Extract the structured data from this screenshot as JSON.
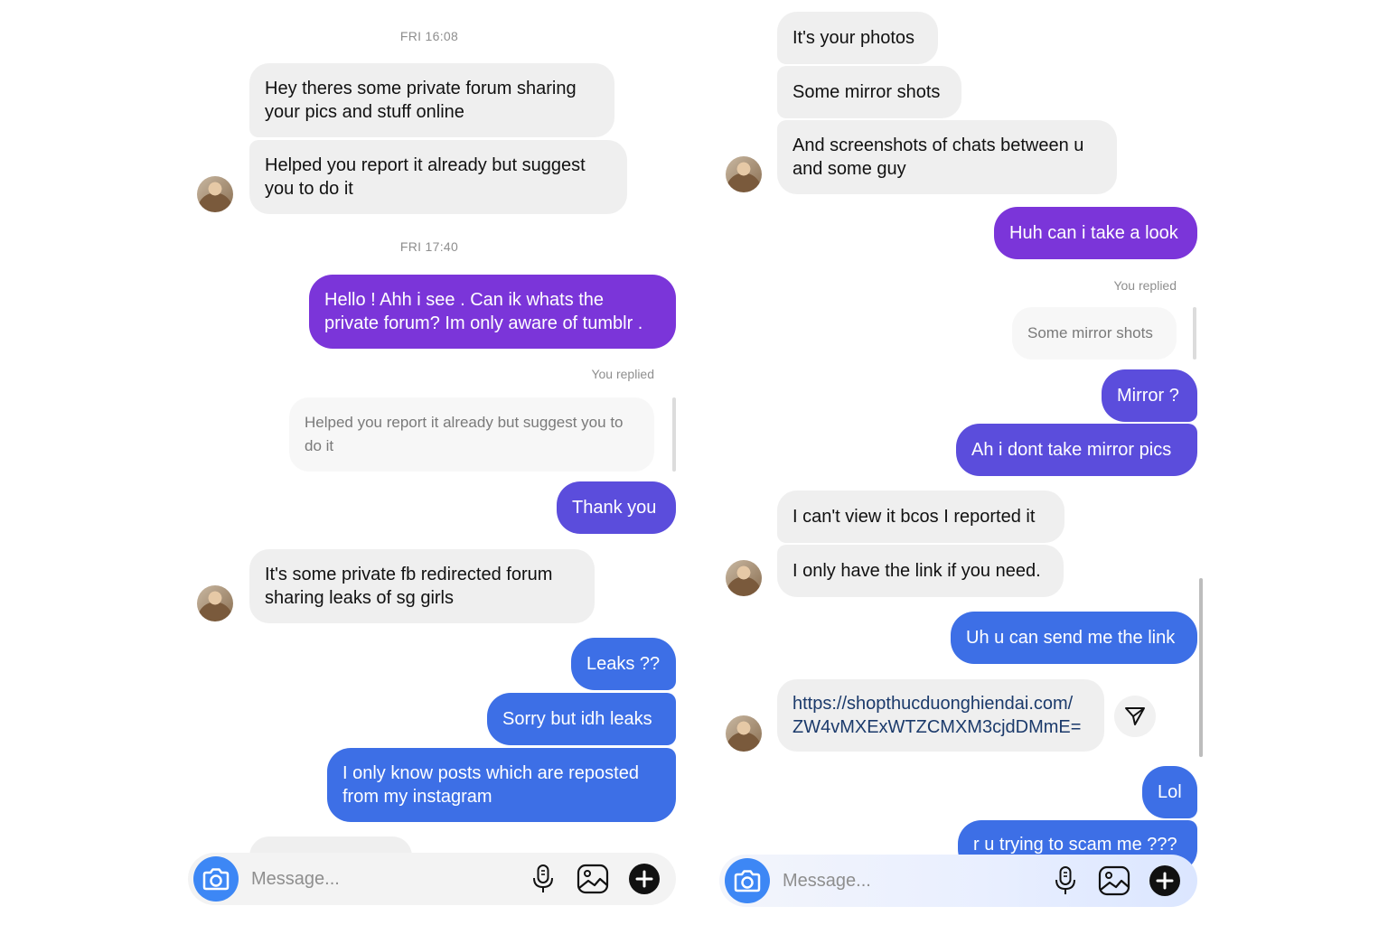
{
  "colors": {
    "purple": "#7b35d9",
    "indigo": "#5b4ddc",
    "blue": "#3d6fe6",
    "incoming": "#efefef",
    "camera": "#3d87f5"
  },
  "left": {
    "timestamp_1": "FRI 16:08",
    "msg_1": "Hey theres some private forum sharing\nyour pics and stuff online",
    "msg_2": "Helped you report it already but suggest\nyou to do it",
    "timestamp_2": "FRI 17:40",
    "msg_3": "Hello ! Ahh i see . Can ik whats the\nprivate forum? Im only aware of tumblr .",
    "you_replied": "You replied",
    "quoted": "Helped you report it already but suggest you\nto do it",
    "msg_4": "Thank you",
    "msg_5": "It's some private fb redirected forum\nsharing leaks of sg girls",
    "msg_6": "Leaks ??",
    "msg_7": "Sorry but idh leaks",
    "msg_8": "I only know posts which are reposted\nfrom my instagram",
    "composer_placeholder": "Message..."
  },
  "right": {
    "msg_1": "It's your photos",
    "msg_2": "Some mirror shots",
    "msg_3": "And screenshots of chats between u\nand some guy",
    "msg_4": "Huh can i take a look",
    "you_replied": "You replied",
    "quoted": "Some mirror shots",
    "msg_5": "Mirror ?",
    "msg_6": "Ah i dont take mirror pics",
    "msg_7": "I can't view it bcos I reported it",
    "msg_8": "I only have the link if you need.",
    "msg_9": "Uh u can send me the link",
    "link": "https://shopthucduonghiendai.com/\nZW4vMXExWTZCMXM3cjdDMmE=",
    "msg_10": "Lol",
    "msg_11": "r u trying to scam me ???",
    "composer_placeholder": "Message..."
  },
  "icons": [
    "camera-icon",
    "microphone-icon",
    "gallery-icon",
    "plus-icon",
    "share-icon"
  ]
}
